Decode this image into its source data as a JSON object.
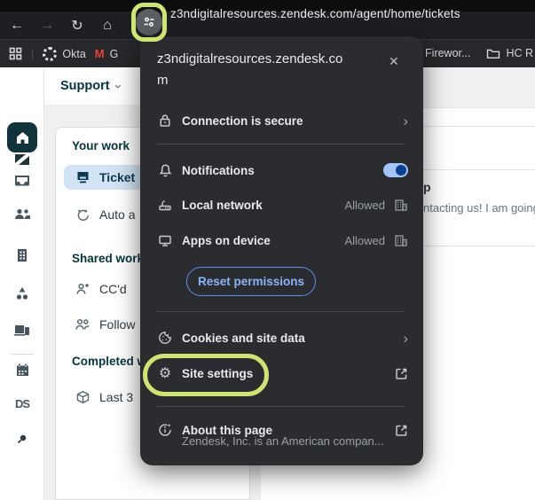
{
  "colors": {
    "highlight_ring": "#cfe571",
    "toolbar_bg": "#1e1f22",
    "popup_bg": "#2b2c2f",
    "toggle_track_on": "#a5c4f8",
    "toggle_thumb_on": "#0b4191",
    "reset_button_blue": "#8ab4f8",
    "zendesk_teal": "#03363d",
    "active_row_bg": "#d2e4f3"
  },
  "icons": {
    "back": "←",
    "forward": "→",
    "reload": "↻",
    "home": "⌂",
    "close": "✕",
    "chevron_right": "›",
    "bookmark_separator": "|",
    "gmail_m": "M",
    "gear": "⚙"
  },
  "browser": {
    "address_url": "z3ndigitalresources.zendesk.com/agent/home/tickets",
    "bookmarks_bar": {
      "okta_label": "Okta",
      "gmail_label": "G",
      "fireworks_label": "Firewor...",
      "hc_label": "HC R"
    }
  },
  "site_info_popup": {
    "title_line1": "z3ndigitalresources.zendesk.co",
    "title_line2": "m",
    "connection_label": "Connection is secure",
    "notifications_label": "Notifications",
    "local_network_label": "Local network",
    "local_network_status": "Allowed",
    "apps_on_device_label": "Apps on device",
    "apps_on_device_status": "Allowed",
    "reset_permissions_label": "Reset permissions",
    "cookies_label": "Cookies and site data",
    "site_settings_label": "Site settings",
    "about_title": "About this page",
    "about_subtitle": "Zendesk, Inc. is an American compan..."
  },
  "zendesk": {
    "product_name": "Support",
    "sidebar_app_label": "DS",
    "nav": {
      "your_work_heading": "Your work",
      "tickets_label": "Ticket",
      "auto_label": "Auto a",
      "shared_heading": "Shared work",
      "ccd_label": "CC'd",
      "following_label": "Follow",
      "completed_heading": "Completed w",
      "last30_label": "Last 3"
    },
    "ticket_table": {
      "subject_fragment": "p",
      "preview_fragment": "ntacting us! I am going to"
    }
  }
}
